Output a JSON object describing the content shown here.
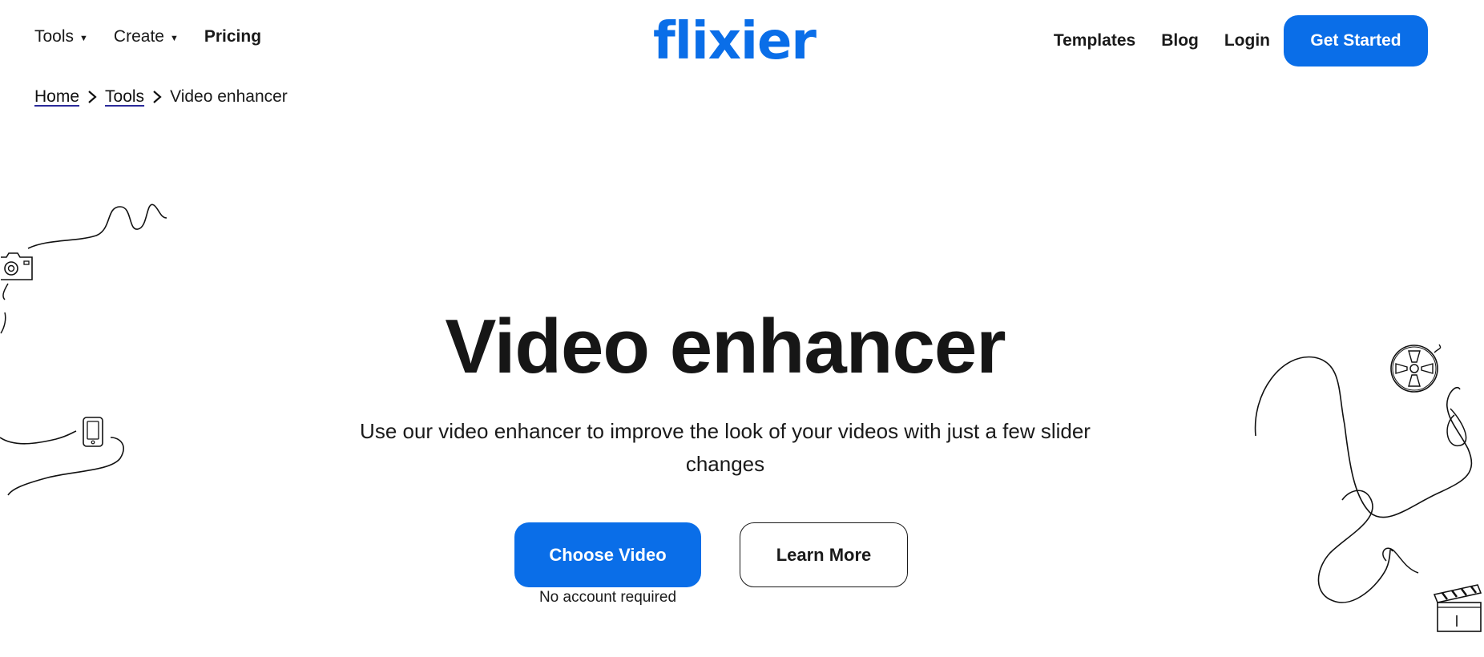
{
  "header": {
    "logo_text": "flixier",
    "left_nav": [
      {
        "label": "Tools",
        "has_dropdown": true
      },
      {
        "label": "Create",
        "has_dropdown": true
      },
      {
        "label": "Pricing",
        "has_dropdown": false
      }
    ],
    "right_nav": [
      {
        "label": "Templates"
      },
      {
        "label": "Blog"
      },
      {
        "label": "Login"
      }
    ],
    "cta_label": "Get Started"
  },
  "breadcrumb": {
    "items": [
      {
        "label": "Home",
        "link": true
      },
      {
        "label": "Tools",
        "link": true
      },
      {
        "label": "Video enhancer",
        "link": false
      }
    ]
  },
  "hero": {
    "title": "Video enhancer",
    "subtitle": "Use our video enhancer to improve the look of your videos with just a few slider changes",
    "primary_button": "Choose Video",
    "secondary_button": "Learn More",
    "note": "No account required"
  },
  "colors": {
    "brand_blue": "#0a6ee8",
    "text": "#111111",
    "background": "#ffffff"
  },
  "icons": {
    "dropdown": "caret-down-icon",
    "breadcrumb_separator": "chevron-right-icon",
    "decorations": [
      "camera-icon",
      "phone-icon",
      "film-reel-icon",
      "clapperboard-icon"
    ]
  }
}
